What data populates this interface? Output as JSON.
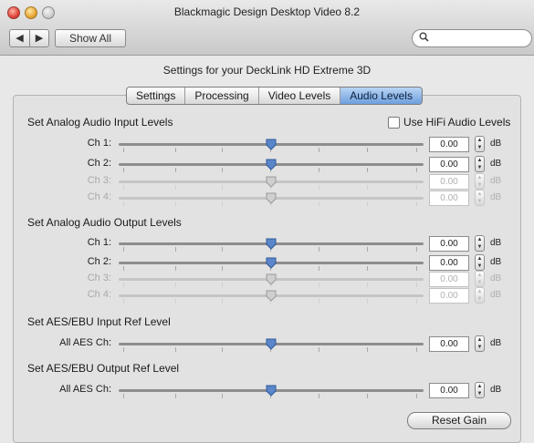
{
  "window": {
    "title": "Blackmagic Design Desktop Video 8.2"
  },
  "toolbar": {
    "back_glyph": "◀",
    "forward_glyph": "▶",
    "show_all_label": "Show All",
    "search_icon": "search-icon"
  },
  "header": {
    "settings_title": "Settings for your DeckLink HD Extreme 3D"
  },
  "tabs": [
    {
      "label": "Settings",
      "active": false
    },
    {
      "label": "Processing",
      "active": false
    },
    {
      "label": "Video Levels",
      "active": false
    },
    {
      "label": "Audio Levels",
      "active": true
    }
  ],
  "hifi": {
    "label": "Use HiFi Audio Levels",
    "checked": false
  },
  "sections": {
    "input_title": "Set Analog Audio Input Levels",
    "output_title": "Set Analog Audio Output Levels",
    "aes_in_title": "Set AES/EBU Input Ref Level",
    "aes_out_title": "Set AES/EBU Output Ref Level"
  },
  "input_rows": [
    {
      "label": "Ch 1:",
      "value": "0.00",
      "unit": "dB",
      "enabled": true,
      "level": 0.5
    },
    {
      "label": "Ch 2:",
      "value": "0.00",
      "unit": "dB",
      "enabled": true,
      "level": 0.5
    },
    {
      "label": "Ch 3:",
      "value": "0.00",
      "unit": "dB",
      "enabled": false,
      "level": 0.5
    },
    {
      "label": "Ch 4:",
      "value": "0.00",
      "unit": "dB",
      "enabled": false,
      "level": 0.5
    }
  ],
  "output_rows": [
    {
      "label": "Ch 1:",
      "value": "0.00",
      "unit": "dB",
      "enabled": true,
      "level": 0.5
    },
    {
      "label": "Ch 2:",
      "value": "0.00",
      "unit": "dB",
      "enabled": true,
      "level": 0.5
    },
    {
      "label": "Ch 3:",
      "value": "0.00",
      "unit": "dB",
      "enabled": false,
      "level": 0.5
    },
    {
      "label": "Ch 4:",
      "value": "0.00",
      "unit": "dB",
      "enabled": false,
      "level": 0.5
    }
  ],
  "aes_in": {
    "label": "All AES Ch:",
    "value": "0.00",
    "unit": "dB",
    "enabled": true,
    "level": 0.5
  },
  "aes_out": {
    "label": "All AES Ch:",
    "value": "0.00",
    "unit": "dB",
    "enabled": true,
    "level": 0.5
  },
  "reset_label": "Reset Gain",
  "colors": {
    "accent": "#6e9fde",
    "thumb": "#5b86c9"
  }
}
